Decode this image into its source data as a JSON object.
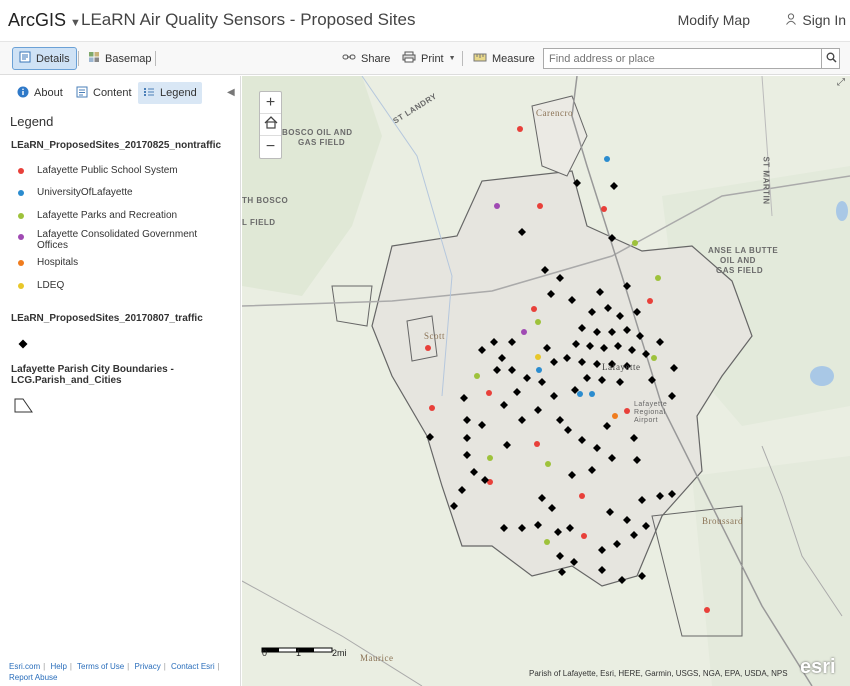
{
  "header": {
    "brand": "ArcGIS",
    "title": "LEaRN Air Quality Sensors - Proposed Sites",
    "modify": "Modify Map",
    "signin": "Sign In"
  },
  "toolbar": {
    "details": "Details",
    "basemap": "Basemap",
    "share": "Share",
    "print": "Print",
    "measure": "Measure",
    "search_placeholder": "Find address or place"
  },
  "panel": {
    "tabs": [
      "About",
      "Content",
      "Legend"
    ],
    "legend_heading": "Legend",
    "layers": [
      {
        "title": "LEaRN_ProposedSites_20170825_nontraffic",
        "items": [
          {
            "label": "Lafayette Public School System",
            "color": "#e8403a"
          },
          {
            "label": "UniversityOfLafayette",
            "color": "#2b8ccf"
          },
          {
            "label": "Lafayette Parks and Recreation",
            "color": "#9ec23b"
          },
          {
            "label": "Lafayette Consolidated Government Offices",
            "color": "#a04ab3"
          },
          {
            "label": "Hospitals",
            "color": "#f07c1e"
          },
          {
            "label": "LDEQ",
            "color": "#e8c72a"
          }
        ]
      },
      {
        "title": "LEaRN_ProposedSites_20170807_traffic"
      },
      {
        "title_line1": "Lafayette Parish City Boundaries -",
        "title_line2": "LCG.Parish_and_Cities"
      }
    ],
    "footer": [
      "Esri.com",
      "Help",
      "Terms of Use",
      "Privacy",
      "Contact Esri",
      "Report Abuse"
    ]
  },
  "map": {
    "labels": {
      "st_landry": "ST LANDRY",
      "carencro": "Carencro",
      "bosco": "BOSCO OIL AND",
      "gas_field": "GAS FIELD",
      "st_martin": "ST MARTIN",
      "anse": "ANSE LA BUTTE",
      "oil_and": "OIL AND",
      "gas_field2": "GAS FIELD",
      "lafayette": "Lafayette",
      "airport": "Lafayette Regional Airport",
      "broussard": "Broussard",
      "maurice": "Maurice",
      "scott": "Scott",
      "th_bosco": "TH BOSCO",
      "l_field": "L FIELD"
    },
    "scale": {
      "t0": "0",
      "t1": "1",
      "t2": "2mi"
    },
    "attribution": "Parish of Lafayette, Esri, HERE, Garmin, USGS, NGA, EPA, USDA, NPS",
    "esri": "esri"
  }
}
